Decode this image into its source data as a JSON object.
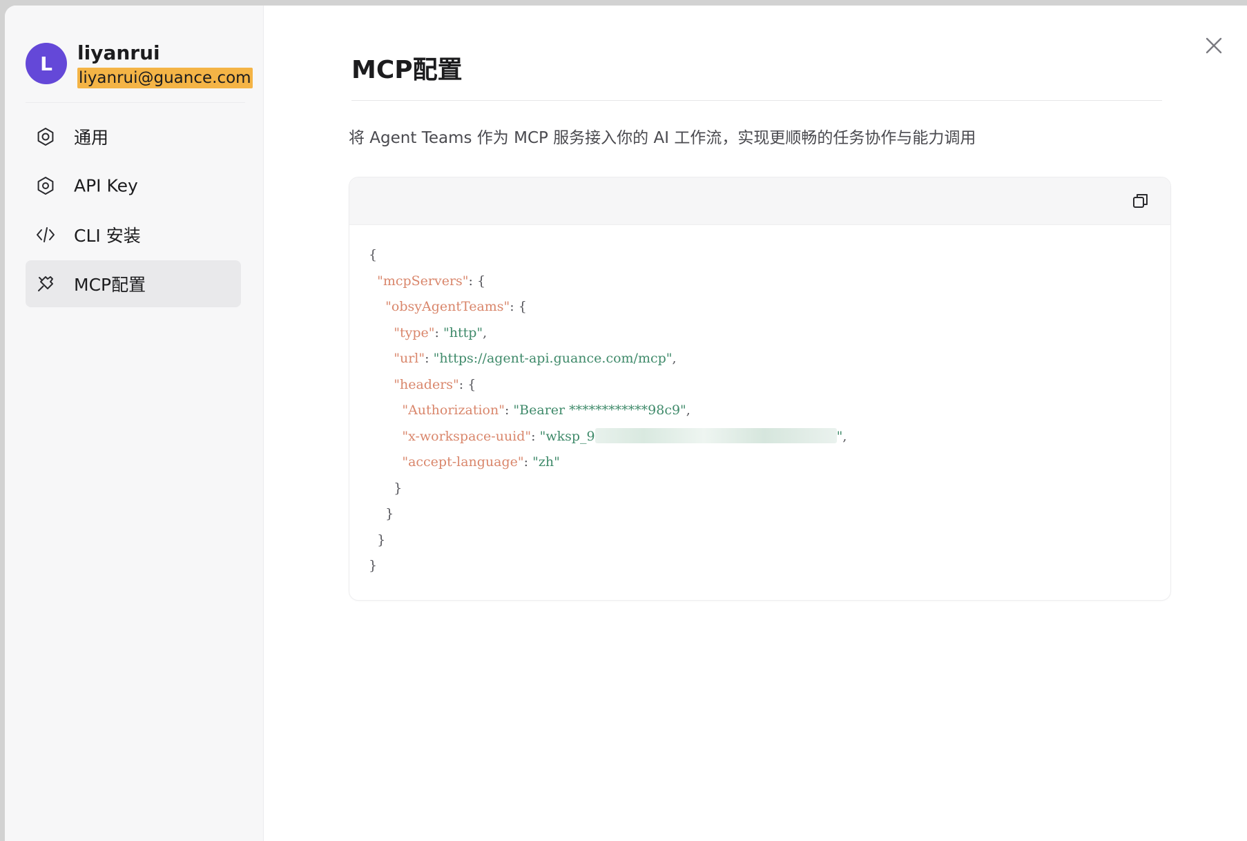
{
  "user": {
    "initial": "L",
    "name": "liyanrui",
    "email": "liyanrui@guance.com"
  },
  "sidebar": {
    "items": [
      {
        "label": "通用",
        "icon": "gear-icon",
        "active": false
      },
      {
        "label": "API Key",
        "icon": "hexagon-key-icon",
        "active": false
      },
      {
        "label": "CLI 安装",
        "icon": "code-icon",
        "active": false
      },
      {
        "label": "MCP配置",
        "icon": "plug-icon",
        "active": true
      }
    ]
  },
  "main": {
    "title": "MCP配置",
    "description": "将 Agent Teams 作为 MCP 服务接入你的 AI 工作流，实现更顺畅的任务协作与能力调用",
    "code": {
      "lines": [
        {
          "indent": "",
          "key": "",
          "sep": "",
          "val": "",
          "tail": "{"
        },
        {
          "indent": "  ",
          "key": "\"mcpServers\"",
          "sep": ": ",
          "val": "",
          "tail": "{"
        },
        {
          "indent": "    ",
          "key": "\"obsyAgentTeams\"",
          "sep": ": ",
          "val": "",
          "tail": "{"
        },
        {
          "indent": "      ",
          "key": "\"type\"",
          "sep": ": ",
          "val": "\"http\"",
          "tail": ","
        },
        {
          "indent": "      ",
          "key": "\"url\"",
          "sep": ": ",
          "val": "\"https://agent-api.guance.com/mcp\"",
          "tail": ","
        },
        {
          "indent": "      ",
          "key": "\"headers\"",
          "sep": ": ",
          "val": "",
          "tail": "{"
        },
        {
          "indent": "        ",
          "key": "\"Authorization\"",
          "sep": ": ",
          "val": "\"Bearer ************98c9\"",
          "tail": ","
        },
        {
          "indent": "        ",
          "key": "\"x-workspace-uuid\"",
          "sep": ": ",
          "val": "\"wksp_9",
          "blurred": true,
          "val2": "\"",
          "tail": ","
        },
        {
          "indent": "        ",
          "key": "\"accept-language\"",
          "sep": ": ",
          "val": "\"zh\"",
          "tail": ""
        },
        {
          "indent": "      ",
          "key": "",
          "sep": "",
          "val": "",
          "tail": "}"
        },
        {
          "indent": "    ",
          "key": "",
          "sep": "",
          "val": "",
          "tail": "}"
        },
        {
          "indent": "  ",
          "key": "",
          "sep": "",
          "val": "",
          "tail": "}"
        },
        {
          "indent": "",
          "key": "",
          "sep": "",
          "val": "",
          "tail": "}"
        }
      ]
    }
  },
  "colors": {
    "avatar": "#6448d8",
    "email_highlight": "#f4b446",
    "json_key": "#d9866b",
    "json_value": "#3f8a6a",
    "active_nav": "#e9e9eb"
  }
}
